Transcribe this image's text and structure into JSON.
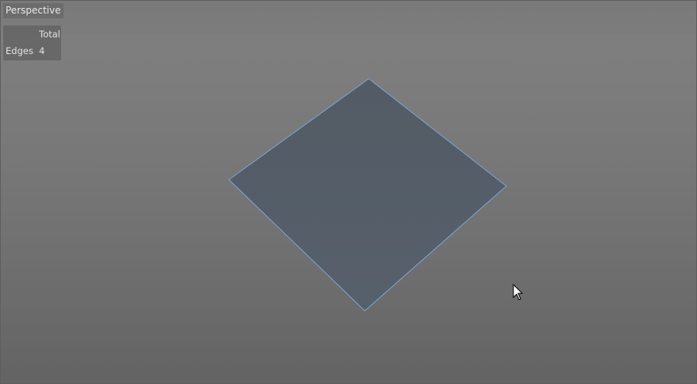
{
  "viewport": {
    "camera_name": "Perspective"
  },
  "hud": {
    "column_header": "Total",
    "rows": [
      {
        "label": "Edges",
        "value": "4"
      }
    ]
  },
  "scene": {
    "object": "plane",
    "face_color": "#545c66",
    "edge_color": "#7aa6d6"
  },
  "icons": {
    "cursor": "mouse-pointer-icon"
  }
}
